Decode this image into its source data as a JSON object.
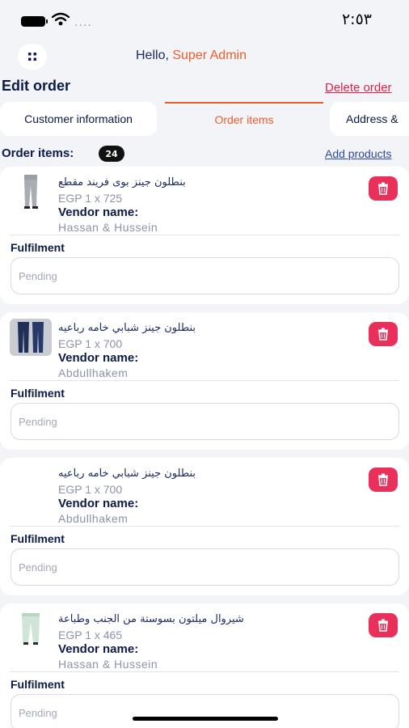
{
  "status_bar": {
    "time": "٢:٥٣",
    "signal_dots": "....",
    "icons": [
      "battery-icon",
      "wifi-icon",
      "signal-icon"
    ]
  },
  "header": {
    "greeting": "Hello,",
    "user_name": "Super Admin",
    "menu_icon": "grid-menu-icon"
  },
  "page": {
    "title": "Edit order",
    "delete_label": "Delete order"
  },
  "tabs": [
    {
      "label": "Customer information",
      "active": false
    },
    {
      "label": "Order items",
      "active": true
    },
    {
      "label": "Address &",
      "active": false
    }
  ],
  "items_section": {
    "label": "Order items:",
    "count": "24",
    "add_label": "Add products"
  },
  "order_items": [
    {
      "name": "بنطلون جينز بوى فريند مقطع",
      "price": "EGP 1 x 725",
      "vendor_label": "Vendor name:",
      "vendor_name": "Hassan & Hussein",
      "fulfilment_label": "Fulfilment",
      "fulfilment_placeholder": "Pending",
      "thumbnail": "grey-jeans-thumbnail"
    },
    {
      "name": "بنطلون جينز شبابي خامه رباعيه",
      "price": "EGP 1 x 700",
      "vendor_label": "Vendor name:",
      "vendor_name": "Abdullhakem",
      "fulfilment_label": "Fulfilment",
      "fulfilment_placeholder": "Pending",
      "thumbnail": "blue-jeans-thumbnail"
    },
    {
      "name": "بنطلون جينز شبابي خامه رباعيه",
      "price": "EGP 1 x 700",
      "vendor_label": "Vendor name:",
      "vendor_name": "Abdullhakem",
      "fulfilment_label": "Fulfilment",
      "fulfilment_placeholder": "Pending",
      "thumbnail": ""
    },
    {
      "name": "شيروال ميلتون بسوستة من الجنب وطباعة",
      "price": "EGP 1 x 465",
      "vendor_label": "Vendor name:",
      "vendor_name": "Hassan & Hussein",
      "fulfilment_label": "Fulfilment",
      "fulfilment_placeholder": "Pending",
      "thumbnail": "mint-sweatpants-thumbnail"
    }
  ],
  "colors": {
    "accent": "#ef5b2a",
    "danger": "#e8305a",
    "navy": "#0b1a47",
    "background": "#f3f4f8"
  }
}
